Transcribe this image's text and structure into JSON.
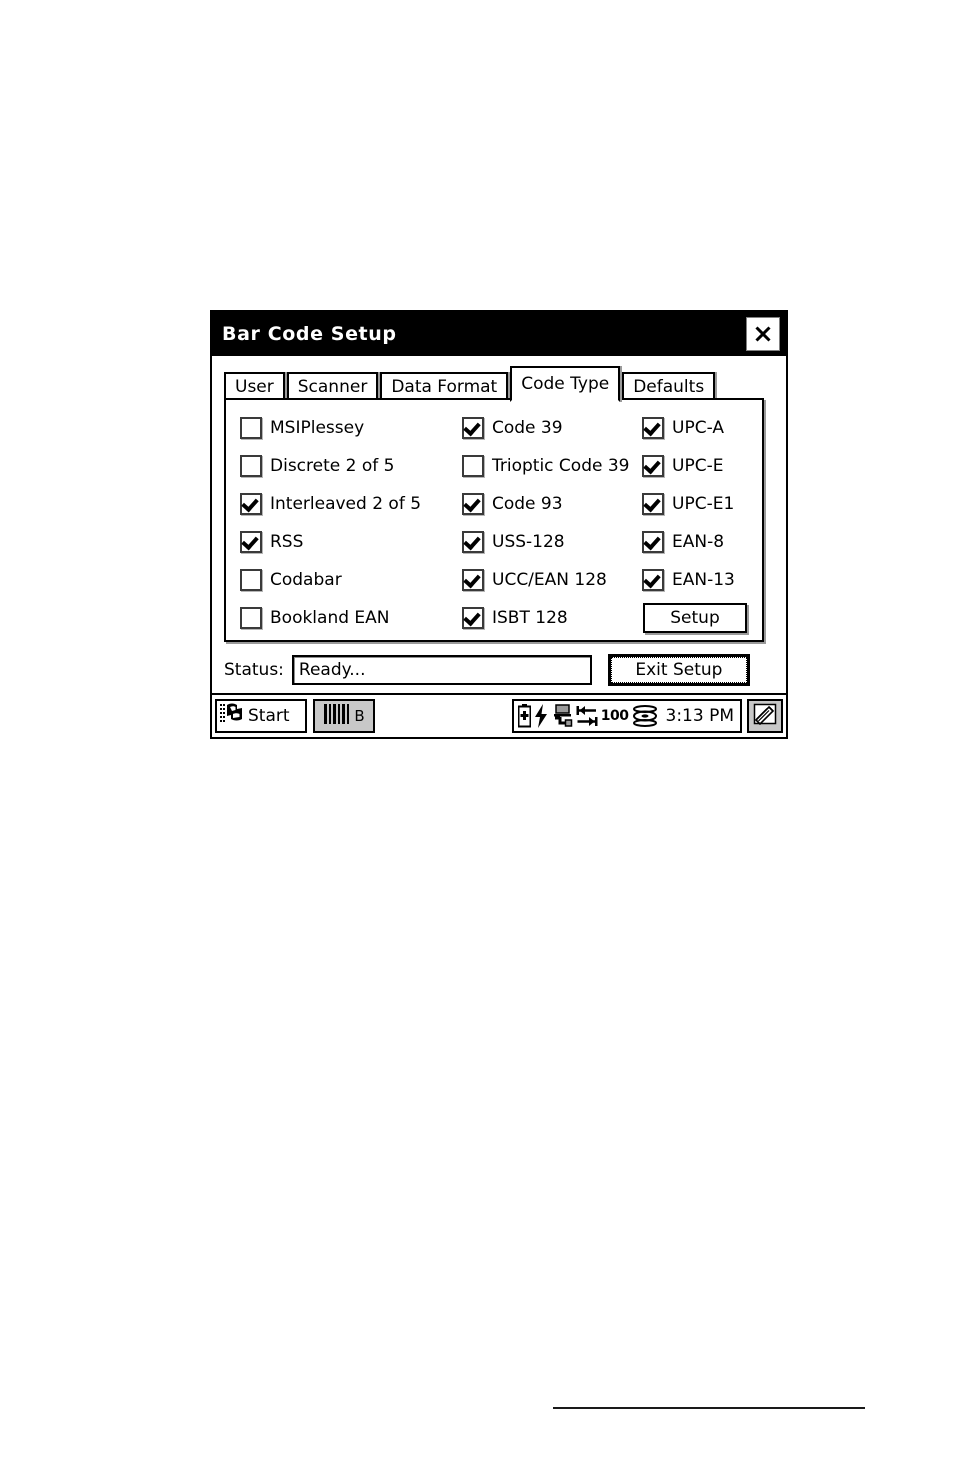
{
  "window": {
    "title": "Bar Code Setup",
    "close_icon": "close-icon"
  },
  "tabs": [
    {
      "label": "User",
      "active": false
    },
    {
      "label": "Scanner",
      "active": false
    },
    {
      "label": "Data Format",
      "active": false
    },
    {
      "label": "Code Type",
      "active": true
    },
    {
      "label": "Defaults",
      "active": false
    }
  ],
  "code_type": {
    "column1": [
      {
        "label": "MSIPlessey",
        "checked": false
      },
      {
        "label": "Discrete 2 of 5",
        "checked": false
      },
      {
        "label": "Interleaved 2 of 5",
        "checked": true
      },
      {
        "label": "RSS",
        "checked": true
      },
      {
        "label": "Codabar",
        "checked": false
      },
      {
        "label": "Bookland EAN",
        "checked": false
      }
    ],
    "column2": [
      {
        "label": "Code 39",
        "checked": true
      },
      {
        "label": "Trioptic Code 39",
        "checked": false
      },
      {
        "label": "Code 93",
        "checked": true
      },
      {
        "label": "USS-128",
        "checked": true
      },
      {
        "label": "UCC/EAN 128",
        "checked": true
      },
      {
        "label": "ISBT 128",
        "checked": true
      }
    ],
    "column3": [
      {
        "label": "UPC-A",
        "checked": true
      },
      {
        "label": "UPC-E",
        "checked": true
      },
      {
        "label": "UPC-E1",
        "checked": true
      },
      {
        "label": "EAN-8",
        "checked": true
      },
      {
        "label": "EAN-13",
        "checked": true
      }
    ],
    "setup_button": "Setup"
  },
  "status": {
    "label": "Status:",
    "value": "Ready...",
    "placeholder": ""
  },
  "exit_button": "Exit Setup",
  "taskbar": {
    "start_label": "Start",
    "start_icon": "windows-flag-icon",
    "task_button_label": "B",
    "task_button_icon": "barcode-icon",
    "tray": {
      "icons": [
        "battery-icon",
        "charging-bolt-icon",
        "network-connection-icon",
        "data-transfer-arrows-icon",
        "disk-stack-icon"
      ],
      "network_speed": "100",
      "time": "3:13 PM"
    },
    "sip_icon": "stylus-keyboard-icon"
  },
  "colors": {
    "titlebar_bg": "#000000",
    "titlebar_text": "#ffffff",
    "window_bg": "#ffffff",
    "border": "#000000",
    "shadow": "#9a9a9a",
    "task_button_bg": "#c8c8c8"
  }
}
